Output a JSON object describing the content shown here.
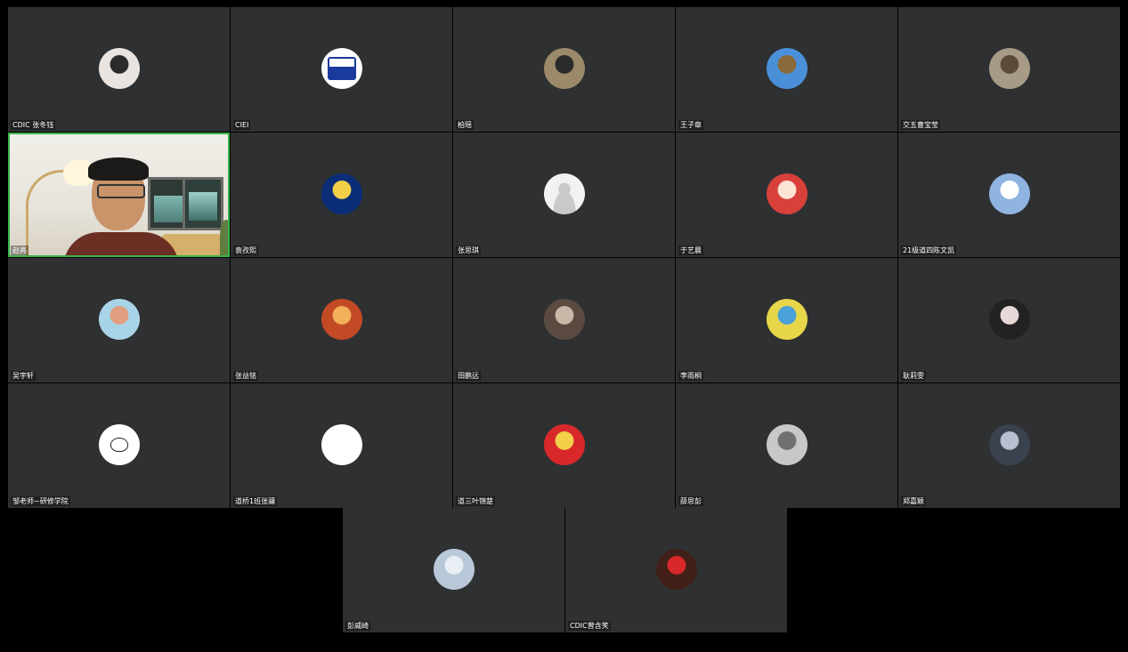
{
  "participants": [
    {
      "name": "CDIC 张冬钰",
      "avatar": "portrait-avatar-icon",
      "bg": "#e9e4df",
      "fg": "#2b2b2b"
    },
    {
      "name": "CIEI",
      "avatar": "school-logo-icon",
      "bg": "#ffffff",
      "fg": "#1a3a9e"
    },
    {
      "name": "柏瑶",
      "avatar": "outdoor-photo-avatar-icon",
      "bg": "#9a8a6a",
      "fg": "#2a2a2a"
    },
    {
      "name": "王子章",
      "avatar": "statue-photo-avatar-icon",
      "bg": "#4a90d9",
      "fg": "#8a6a3a"
    },
    {
      "name": "交五曹宝莹",
      "avatar": "landscape-photo-avatar-icon",
      "bg": "#a79a86",
      "fg": "#5a4a36"
    },
    {
      "name": "赵亮",
      "video": true
    },
    {
      "name": "袁孜熙",
      "avatar": "chelsea-crest-icon",
      "bg": "#0b2d78",
      "fg": "#f2d04a"
    },
    {
      "name": "张思琪",
      "avatar": "default-user-icon",
      "bg": "#f2f2f2",
      "fg": "#c9c9c9"
    },
    {
      "name": "于艺晨",
      "avatar": "anime-girl-avatar-icon",
      "bg": "#d8413a",
      "fg": "#fbe3d6"
    },
    {
      "name": "21级道四陈文凯",
      "avatar": "cartoon-cat-avatar-icon",
      "bg": "#8fb4e0",
      "fg": "#ffffff"
    },
    {
      "name": "吴宇轩",
      "avatar": "sky-photo-avatar-icon",
      "bg": "#a8d4e8",
      "fg": "#e0a080"
    },
    {
      "name": "张益铭",
      "avatar": "anime-hero-avatar-icon",
      "bg": "#c24a24",
      "fg": "#f2b05a"
    },
    {
      "name": "田鹏远",
      "avatar": "indoor-photo-avatar-icon",
      "bg": "#5a4a40",
      "fg": "#c8b8a8"
    },
    {
      "name": "李雨桐",
      "avatar": "pikachu-avatar-icon",
      "bg": "#e8d64a",
      "fg": "#4aa0d8"
    },
    {
      "name": "耿莉雯",
      "avatar": "dark-portrait-avatar-icon",
      "bg": "#222222",
      "fg": "#e8d8d8"
    },
    {
      "name": "邹老师~研修学院",
      "avatar": "doodle-cat-avatar-icon",
      "bg": "#ffffff",
      "fg": "#222222"
    },
    {
      "name": "道桥1班张骧",
      "avatar": "blank-white-avatar-icon",
      "bg": "#ffffff",
      "fg": "#ffffff"
    },
    {
      "name": "道三叶锦楚",
      "avatar": "flag-portrait-avatar-icon",
      "bg": "#d8282a",
      "fg": "#f2d04a"
    },
    {
      "name": "薛思彭",
      "avatar": "sketch-girl-avatar-icon",
      "bg": "#c8c8c8",
      "fg": "#707070"
    },
    {
      "name": "郑嘉颖",
      "avatar": "dim-portrait-avatar-icon",
      "bg": "#3a4250",
      "fg": "#b8c0d0"
    }
  ],
  "bottom_participants": [
    {
      "name": "彭威崎",
      "avatar": "snowy-art-avatar-icon",
      "bg": "#b8c8d8",
      "fg": "#e8eef4"
    },
    {
      "name": "CDIC曾含笑",
      "avatar": "red-dress-avatar-icon",
      "bg": "#402018",
      "fg": "#d8282a"
    }
  ],
  "colors": {
    "tile": "#2e3032",
    "active_speaker": "#39b54a",
    "background": "#000000"
  }
}
